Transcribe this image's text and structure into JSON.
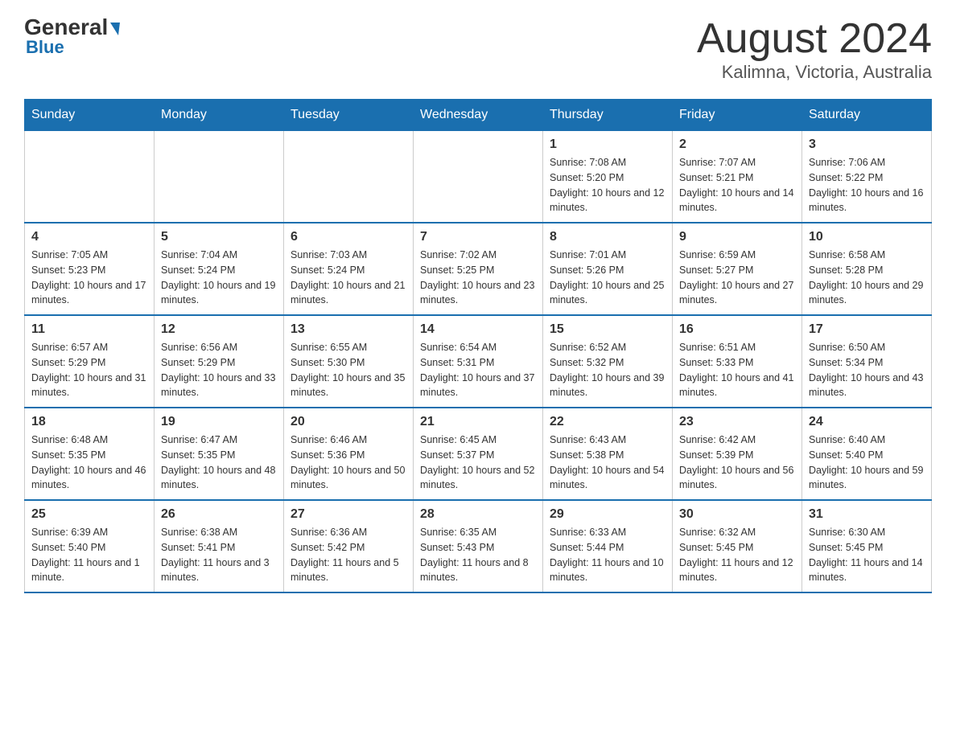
{
  "header": {
    "logo_general": "General",
    "logo_blue": "Blue",
    "title": "August 2024",
    "subtitle": "Kalimna, Victoria, Australia"
  },
  "weekdays": [
    "Sunday",
    "Monday",
    "Tuesday",
    "Wednesday",
    "Thursday",
    "Friday",
    "Saturday"
  ],
  "weeks": [
    [
      {
        "day": "",
        "info": ""
      },
      {
        "day": "",
        "info": ""
      },
      {
        "day": "",
        "info": ""
      },
      {
        "day": "",
        "info": ""
      },
      {
        "day": "1",
        "info": "Sunrise: 7:08 AM\nSunset: 5:20 PM\nDaylight: 10 hours and 12 minutes."
      },
      {
        "day": "2",
        "info": "Sunrise: 7:07 AM\nSunset: 5:21 PM\nDaylight: 10 hours and 14 minutes."
      },
      {
        "day": "3",
        "info": "Sunrise: 7:06 AM\nSunset: 5:22 PM\nDaylight: 10 hours and 16 minutes."
      }
    ],
    [
      {
        "day": "4",
        "info": "Sunrise: 7:05 AM\nSunset: 5:23 PM\nDaylight: 10 hours and 17 minutes."
      },
      {
        "day": "5",
        "info": "Sunrise: 7:04 AM\nSunset: 5:24 PM\nDaylight: 10 hours and 19 minutes."
      },
      {
        "day": "6",
        "info": "Sunrise: 7:03 AM\nSunset: 5:24 PM\nDaylight: 10 hours and 21 minutes."
      },
      {
        "day": "7",
        "info": "Sunrise: 7:02 AM\nSunset: 5:25 PM\nDaylight: 10 hours and 23 minutes."
      },
      {
        "day": "8",
        "info": "Sunrise: 7:01 AM\nSunset: 5:26 PM\nDaylight: 10 hours and 25 minutes."
      },
      {
        "day": "9",
        "info": "Sunrise: 6:59 AM\nSunset: 5:27 PM\nDaylight: 10 hours and 27 minutes."
      },
      {
        "day": "10",
        "info": "Sunrise: 6:58 AM\nSunset: 5:28 PM\nDaylight: 10 hours and 29 minutes."
      }
    ],
    [
      {
        "day": "11",
        "info": "Sunrise: 6:57 AM\nSunset: 5:29 PM\nDaylight: 10 hours and 31 minutes."
      },
      {
        "day": "12",
        "info": "Sunrise: 6:56 AM\nSunset: 5:29 PM\nDaylight: 10 hours and 33 minutes."
      },
      {
        "day": "13",
        "info": "Sunrise: 6:55 AM\nSunset: 5:30 PM\nDaylight: 10 hours and 35 minutes."
      },
      {
        "day": "14",
        "info": "Sunrise: 6:54 AM\nSunset: 5:31 PM\nDaylight: 10 hours and 37 minutes."
      },
      {
        "day": "15",
        "info": "Sunrise: 6:52 AM\nSunset: 5:32 PM\nDaylight: 10 hours and 39 minutes."
      },
      {
        "day": "16",
        "info": "Sunrise: 6:51 AM\nSunset: 5:33 PM\nDaylight: 10 hours and 41 minutes."
      },
      {
        "day": "17",
        "info": "Sunrise: 6:50 AM\nSunset: 5:34 PM\nDaylight: 10 hours and 43 minutes."
      }
    ],
    [
      {
        "day": "18",
        "info": "Sunrise: 6:48 AM\nSunset: 5:35 PM\nDaylight: 10 hours and 46 minutes."
      },
      {
        "day": "19",
        "info": "Sunrise: 6:47 AM\nSunset: 5:35 PM\nDaylight: 10 hours and 48 minutes."
      },
      {
        "day": "20",
        "info": "Sunrise: 6:46 AM\nSunset: 5:36 PM\nDaylight: 10 hours and 50 minutes."
      },
      {
        "day": "21",
        "info": "Sunrise: 6:45 AM\nSunset: 5:37 PM\nDaylight: 10 hours and 52 minutes."
      },
      {
        "day": "22",
        "info": "Sunrise: 6:43 AM\nSunset: 5:38 PM\nDaylight: 10 hours and 54 minutes."
      },
      {
        "day": "23",
        "info": "Sunrise: 6:42 AM\nSunset: 5:39 PM\nDaylight: 10 hours and 56 minutes."
      },
      {
        "day": "24",
        "info": "Sunrise: 6:40 AM\nSunset: 5:40 PM\nDaylight: 10 hours and 59 minutes."
      }
    ],
    [
      {
        "day": "25",
        "info": "Sunrise: 6:39 AM\nSunset: 5:40 PM\nDaylight: 11 hours and 1 minute."
      },
      {
        "day": "26",
        "info": "Sunrise: 6:38 AM\nSunset: 5:41 PM\nDaylight: 11 hours and 3 minutes."
      },
      {
        "day": "27",
        "info": "Sunrise: 6:36 AM\nSunset: 5:42 PM\nDaylight: 11 hours and 5 minutes."
      },
      {
        "day": "28",
        "info": "Sunrise: 6:35 AM\nSunset: 5:43 PM\nDaylight: 11 hours and 8 minutes."
      },
      {
        "day": "29",
        "info": "Sunrise: 6:33 AM\nSunset: 5:44 PM\nDaylight: 11 hours and 10 minutes."
      },
      {
        "day": "30",
        "info": "Sunrise: 6:32 AM\nSunset: 5:45 PM\nDaylight: 11 hours and 12 minutes."
      },
      {
        "day": "31",
        "info": "Sunrise: 6:30 AM\nSunset: 5:45 PM\nDaylight: 11 hours and 14 minutes."
      }
    ]
  ]
}
